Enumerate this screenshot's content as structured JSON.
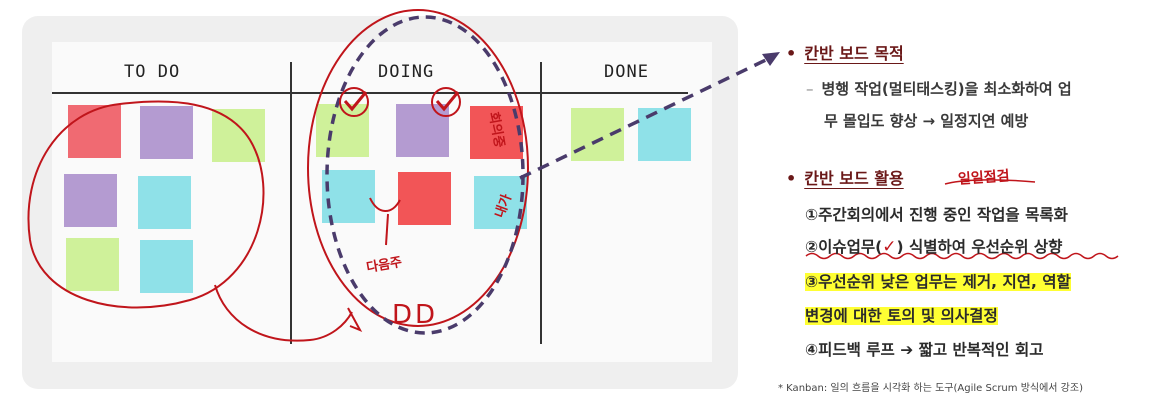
{
  "board": {
    "columns": [
      "TO DO",
      "DOING",
      "DONE"
    ],
    "handwriting": {
      "doing_note": "회의중",
      "mine_note": "내가",
      "next_week": "다음주",
      "deadline": "DD",
      "daily_check": "일일점검"
    }
  },
  "panel": {
    "bullet1": {
      "title": "칸반 보드 목적",
      "line1": "병행 작업(멀티태스킹)을 최소화하여 업",
      "line2": "무 몰입도 향상 → 일정지연 예방"
    },
    "bullet2": {
      "title": "칸반 보드 활용",
      "item1": "①주간회의에서 진행 중인 작업을 목록화",
      "item2a": "②이슈업무(",
      "item2b": ") 식별하여 우선순위 상향",
      "item3a": "③우선순위 낮은 업무는 제거, 지연, 역할",
      "item3b": "변경에 대한 토의 및 의사결정",
      "item4": "④피드백 루프 ➔ 짧고 반복적인 회고"
    },
    "footnote": "* Kanban: 일의 흐름을 시각화 하는 도구(Agile Scrum 방식에서 강조)"
  },
  "colors": {
    "pink": "#f06a72",
    "purple": "#b49bd1",
    "lime": "#cff19a",
    "cyan": "#8fe1e8",
    "red": "#f25557",
    "ink_red": "#c0151b",
    "arrow": "#4a3b6b",
    "highlight": "#ffff33"
  },
  "icons": [
    "checkmark-icon",
    "arrow-icon"
  ]
}
